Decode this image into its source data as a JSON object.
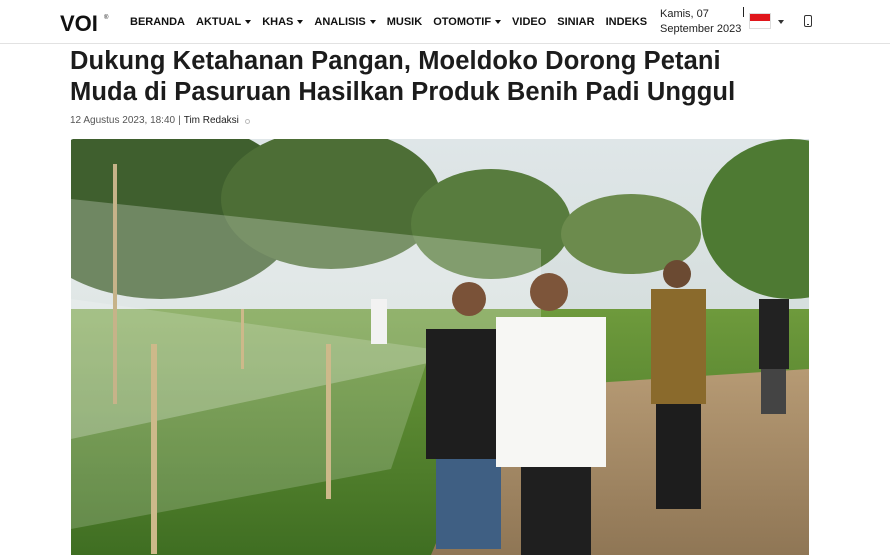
{
  "header": {
    "logo_text": "VOI",
    "nav": [
      {
        "label": "BERANDA",
        "dropdown": false
      },
      {
        "label": "AKTUAL",
        "dropdown": true
      },
      {
        "label": "KHAS",
        "dropdown": true
      },
      {
        "label": "ANALISIS",
        "dropdown": true
      },
      {
        "label": "MUSIK",
        "dropdown": false
      },
      {
        "label": "OTOMOTIF",
        "dropdown": true
      },
      {
        "label": "VIDEO",
        "dropdown": false
      },
      {
        "label": "SINIAR",
        "dropdown": false
      },
      {
        "label": "INDEKS",
        "dropdown": false
      }
    ],
    "date_line1": "Kamis, 07",
    "date_line2": "September 2023",
    "language_flag": "indonesia-flag",
    "colors": {
      "flag_red": "#e0161b",
      "flag_white": "#ffffff",
      "logo": "#111111"
    }
  },
  "article": {
    "title_line1": "Dukung Ketahanan Pangan, Moeldoko Dorong Petani",
    "title_line2": "Muda di Pasuruan Hasilkan Produk Benih Padi Unggul",
    "meta_date": "12 Agustus 2023, 18:40",
    "meta_separator": "|",
    "meta_author": "Tim Redaksi",
    "photo_icon": "hero-photo"
  }
}
